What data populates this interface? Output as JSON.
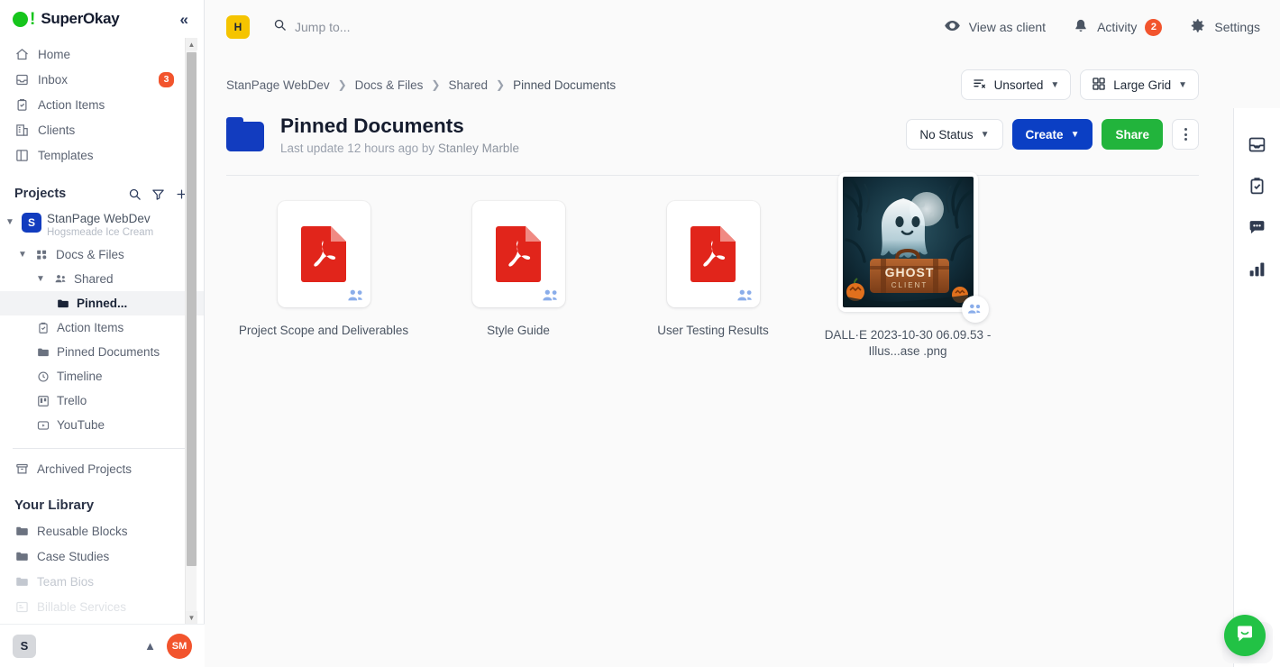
{
  "brand": {
    "name": "SuperOkay",
    "collapse_icon": "chevrons-left-icon"
  },
  "sidebar": {
    "nav": [
      {
        "label": "Home",
        "icon": "home-icon",
        "badge": null
      },
      {
        "label": "Inbox",
        "icon": "inbox-icon",
        "badge": "3"
      },
      {
        "label": "Action Items",
        "icon": "clipboard-check-icon",
        "badge": null
      },
      {
        "label": "Clients",
        "icon": "building-icon",
        "badge": null
      },
      {
        "label": "Templates",
        "icon": "layout-icon",
        "badge": null
      }
    ],
    "projects_section": {
      "title": "Projects",
      "search_icon": "search-icon",
      "filter_icon": "filter-icon",
      "add_icon": "plus-icon"
    },
    "project": {
      "initial": "S",
      "name": "StanPage WebDev",
      "subtitle": "Hogsmeade Ice Cream"
    },
    "tree": [
      {
        "label": "Docs & Files",
        "icon": "docs-files-icon",
        "level": 1,
        "expanded": true,
        "active": false
      },
      {
        "label": "Shared",
        "icon": "people-icon",
        "level": 2,
        "expanded": true,
        "active": false
      },
      {
        "label": "Pinned...",
        "icon": "folder-icon",
        "level": 3,
        "expanded": false,
        "active": true
      },
      {
        "label": "Action Items",
        "icon": "clipboard-check-icon",
        "level": "leaf",
        "active": false
      },
      {
        "label": "Pinned Documents",
        "icon": "folder-icon",
        "level": "leaf",
        "active": false
      },
      {
        "label": "Timeline",
        "icon": "clock-icon",
        "level": "leaf",
        "active": false
      },
      {
        "label": "Trello",
        "icon": "trello-icon",
        "level": "leaf",
        "active": false
      },
      {
        "label": "YouTube",
        "icon": "youtube-icon",
        "level": "leaf",
        "active": false
      }
    ],
    "archived": {
      "label": "Archived Projects",
      "icon": "archive-icon"
    },
    "library_title": "Your Library",
    "library": [
      {
        "label": "Reusable Blocks",
        "icon": "folder-icon",
        "dim": "none"
      },
      {
        "label": "Case Studies",
        "icon": "folder-icon",
        "dim": "none"
      },
      {
        "label": "Team Bios",
        "icon": "folder-icon",
        "dim": "fade"
      },
      {
        "label": "Billable Services",
        "icon": "list-icon",
        "dim": "fade2"
      }
    ],
    "footer": {
      "workspace_initial": "S",
      "user_initials": "SM",
      "caret_icon": "chevron-up-icon"
    }
  },
  "topbar": {
    "workspace_badge": "H",
    "search": {
      "placeholder": "Jump to...",
      "icon": "search-icon"
    },
    "actions": [
      {
        "label": "View as client",
        "icon": "eye-icon",
        "badge": null
      },
      {
        "label": "Activity",
        "icon": "bell-icon",
        "badge": "2"
      },
      {
        "label": "Settings",
        "icon": "gear-icon",
        "badge": null
      }
    ]
  },
  "breadcrumb": [
    "StanPage WebDev",
    "Docs & Files",
    "Shared",
    "Pinned Documents"
  ],
  "toolbar": {
    "sort": {
      "label": "Unsorted",
      "icon": "sort-off-icon"
    },
    "view": {
      "label": "Large Grid",
      "icon": "grid-icon"
    }
  },
  "page": {
    "title": "Pinned Documents",
    "subtitle_prefix": "Last update 12 hours ago by",
    "subtitle_author": "Stanley Marble",
    "folder_icon": "folder-icon",
    "status": {
      "label": "No Status"
    },
    "create": {
      "label": "Create"
    },
    "share": {
      "label": "Share"
    },
    "more": {
      "icon": "more-vertical-icon"
    }
  },
  "files": [
    {
      "name": "Project Scope and Deliverables",
      "type": "pdf",
      "shared": true
    },
    {
      "name": "Style Guide",
      "type": "pdf",
      "shared": true
    },
    {
      "name": "User Testing Results",
      "type": "pdf",
      "shared": true
    },
    {
      "name": "DALL·E 2023-10-30 06.09.53 - Illus...ase .png",
      "type": "image",
      "shared": true,
      "image_caption": "GHOST CLIENT"
    }
  ],
  "rail": [
    {
      "icon": "inbox-tray-icon"
    },
    {
      "icon": "clipboard-check-icon"
    },
    {
      "icon": "comment-icon"
    },
    {
      "icon": "bar-chart-icon"
    }
  ],
  "chat": {
    "icon": "chat-bubble-icon"
  },
  "colors": {
    "brand_green": "#16c51c",
    "accent_blue": "#0b3fc4",
    "share_green": "#22b43c",
    "badge_orange": "#f2542d",
    "pdf_red": "#e1251b",
    "workspace_yellow": "#f5c400"
  }
}
